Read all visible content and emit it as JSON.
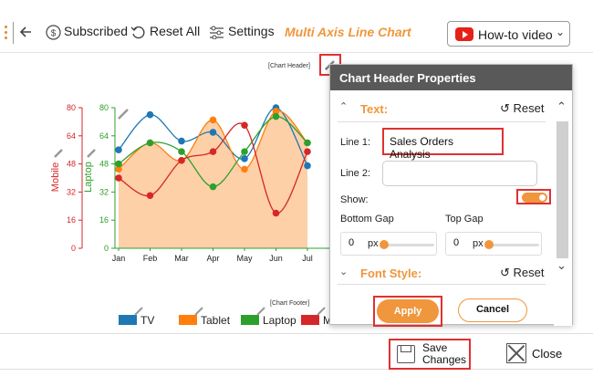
{
  "toolbar": {
    "subscribed_label": "Subscribed",
    "reset_all_label": "Reset All",
    "settings_label": "Settings",
    "title": "Multi Axis Line Chart",
    "howto_label": "How-to video"
  },
  "chart": {
    "header_tag": "[Chart Header]",
    "footer_tag": "[Chart Footer]"
  },
  "chart_data": {
    "type": "line",
    "categories": [
      "Jan",
      "Feb",
      "Mar",
      "Apr",
      "May",
      "Jun",
      "Jul"
    ],
    "series": [
      {
        "name": "TV",
        "values": [
          56,
          76,
          61,
          66,
          51,
          80,
          47
        ]
      },
      {
        "name": "Tablet",
        "values": [
          45,
          60,
          50,
          73,
          45,
          78,
          60
        ]
      },
      {
        "name": "Laptop",
        "values": [
          48,
          60,
          55,
          35,
          55,
          75,
          60
        ]
      },
      {
        "name": "Mobile",
        "values": [
          40,
          30,
          50,
          55,
          70,
          20,
          55
        ]
      }
    ],
    "axes": [
      {
        "label": "Mobile",
        "ticks": [
          "80",
          "64",
          "48",
          "32",
          "16",
          "0"
        ],
        "color": "#d62728"
      },
      {
        "label": "Laptop",
        "ticks": [
          "80",
          "64",
          "48",
          "32",
          "16",
          "0"
        ],
        "color": "#2ca02c"
      }
    ],
    "ylim": [
      0,
      80
    ],
    "colors": {
      "TV": "#1f77b4",
      "Tablet": "#ff7f0e",
      "Laptop": "#2ca02c",
      "Mobile": "#d62728",
      "area": "#fdd0a8"
    },
    "legend_position": "bottom",
    "legend": [
      "TV",
      "Tablet",
      "Laptop",
      "M"
    ]
  },
  "panel": {
    "title": "Chart Header Properties",
    "text_section": "Text:",
    "reset_label": "Reset",
    "line1_label": "Line 1:",
    "line1_value": "Sales Orders Analysis",
    "line2_label": "Line 2:",
    "line2_value": "",
    "show_label": "Show:",
    "show_on": true,
    "bottom_gap_label": "Bottom Gap",
    "top_gap_label": "Top Gap",
    "bottom_gap_value": "0",
    "top_gap_value": "0",
    "unit": "px",
    "font_style_section": "Font Style:",
    "font_reset_label": "Reset",
    "apply_label": "Apply",
    "cancel_label": "Cancel"
  },
  "footer": {
    "save_label_line1": "Save",
    "save_label_line2": "Changes",
    "close_label": "Close"
  },
  "icons": [
    "menu-dots-icon",
    "back-arrow-icon",
    "dollar-icon",
    "reset-icon",
    "settings-sliders-icon",
    "youtube-icon",
    "chevron-down-icon",
    "pencil-icon",
    "chevron-up-icon",
    "save-icon",
    "close-icon"
  ]
}
